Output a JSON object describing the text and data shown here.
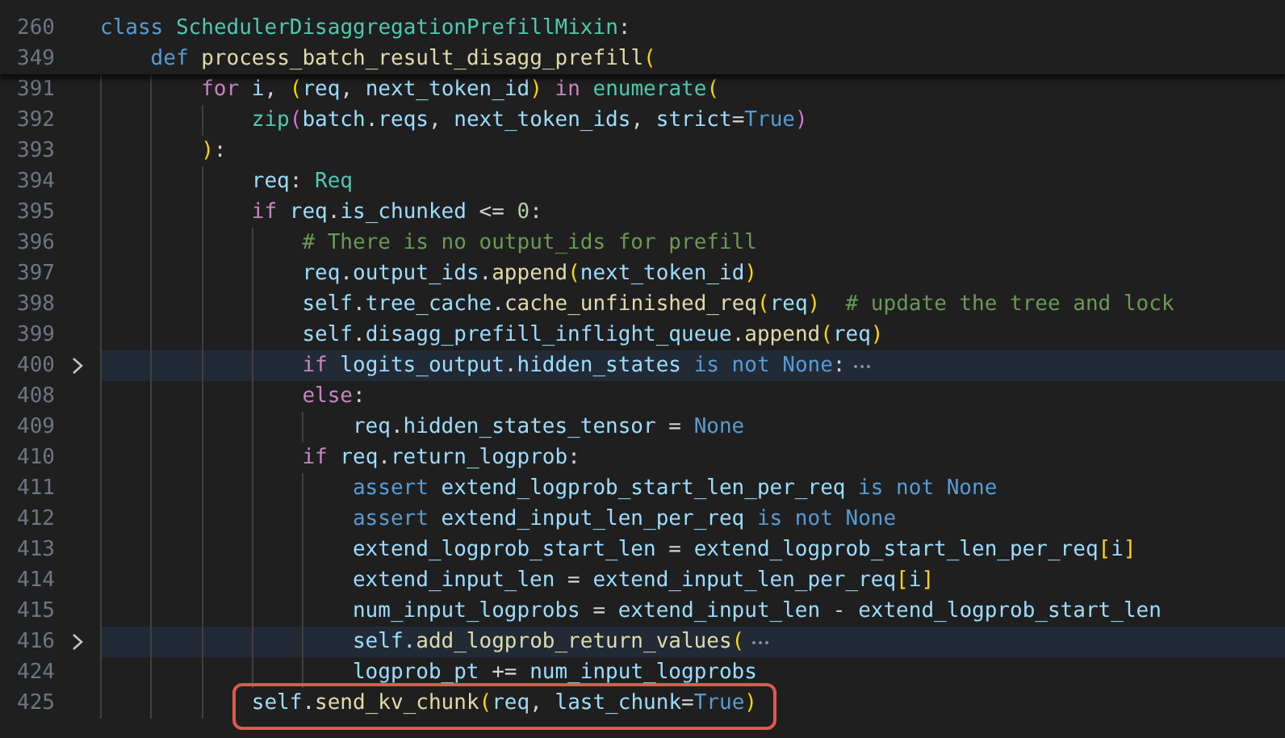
{
  "editor": {
    "sticky_lines": [
      {
        "number": "260",
        "segments": [
          {
            "kind": "kw",
            "text": "class "
          },
          {
            "kind": "cls",
            "text": "SchedulerDisaggregationPrefillMixin"
          },
          {
            "kind": "plain",
            "text": ":"
          }
        ],
        "children": [
          {
            "number": "349",
            "segments": [
              {
                "kind": "kw",
                "text": "def "
              },
              {
                "kind": "fn",
                "text": "process_batch_result_disagg_prefill"
              },
              {
                "kind": "b1",
                "text": "("
              }
            ]
          }
        ]
      }
    ],
    "lines": [
      {
        "number": "391",
        "folded": false,
        "boxed": false,
        "segments": [
          {
            "kind": "ctl",
            "text": "for "
          },
          {
            "kind": "var",
            "text": "i"
          },
          {
            "kind": "plain",
            "text": ", "
          },
          {
            "kind": "b1",
            "text": "("
          },
          {
            "kind": "var",
            "text": "req"
          },
          {
            "kind": "plain",
            "text": ", "
          },
          {
            "kind": "var",
            "text": "next_token_id"
          },
          {
            "kind": "b1",
            "text": ")"
          },
          {
            "kind": "ctl",
            "text": " in "
          },
          {
            "kind": "cls",
            "text": "enumerate"
          },
          {
            "kind": "b1",
            "text": "("
          }
        ],
        "children": [
          {
            "number": "392",
            "folded": false,
            "boxed": false,
            "segments": [
              {
                "kind": "cls",
                "text": "zip"
              },
              {
                "kind": "b2",
                "text": "("
              },
              {
                "kind": "var",
                "text": "batch"
              },
              {
                "kind": "plain",
                "text": "."
              },
              {
                "kind": "var",
                "text": "reqs"
              },
              {
                "kind": "plain",
                "text": ", "
              },
              {
                "kind": "var",
                "text": "next_token_ids"
              },
              {
                "kind": "plain",
                "text": ", "
              },
              {
                "kind": "var",
                "text": "strict"
              },
              {
                "kind": "plain",
                "text": "="
              },
              {
                "kind": "kw",
                "text": "True"
              },
              {
                "kind": "b2",
                "text": ")"
              }
            ]
          }
        ]
      },
      {
        "number": "393",
        "folded": false,
        "boxed": false,
        "segments": [
          {
            "kind": "b1",
            "text": ")"
          },
          {
            "kind": "plain",
            "text": ":"
          }
        ],
        "children": [
          {
            "number": "394",
            "folded": false,
            "boxed": false,
            "segments": [
              {
                "kind": "var",
                "text": "req"
              },
              {
                "kind": "plain",
                "text": ": "
              },
              {
                "kind": "cls",
                "text": "Req"
              }
            ]
          },
          {
            "number": "395",
            "folded": false,
            "boxed": false,
            "segments": [
              {
                "kind": "ctl",
                "text": "if "
              },
              {
                "kind": "var",
                "text": "req"
              },
              {
                "kind": "plain",
                "text": "."
              },
              {
                "kind": "var",
                "text": "is_chunked"
              },
              {
                "kind": "plain",
                "text": " <= "
              },
              {
                "kind": "num",
                "text": "0"
              },
              {
                "kind": "plain",
                "text": ":"
              }
            ],
            "children": [
              {
                "number": "396",
                "folded": false,
                "boxed": false,
                "segments": [
                  {
                    "kind": "comment",
                    "text": "# There is no output_ids for prefill"
                  }
                ]
              },
              {
                "number": "397",
                "folded": false,
                "boxed": false,
                "segments": [
                  {
                    "kind": "var",
                    "text": "req"
                  },
                  {
                    "kind": "plain",
                    "text": "."
                  },
                  {
                    "kind": "var",
                    "text": "output_ids"
                  },
                  {
                    "kind": "plain",
                    "text": "."
                  },
                  {
                    "kind": "fn",
                    "text": "append"
                  },
                  {
                    "kind": "b1",
                    "text": "("
                  },
                  {
                    "kind": "var",
                    "text": "next_token_id"
                  },
                  {
                    "kind": "b1",
                    "text": ")"
                  }
                ]
              },
              {
                "number": "398",
                "folded": false,
                "boxed": false,
                "segments": [
                  {
                    "kind": "var",
                    "text": "self"
                  },
                  {
                    "kind": "plain",
                    "text": "."
                  },
                  {
                    "kind": "var",
                    "text": "tree_cache"
                  },
                  {
                    "kind": "plain",
                    "text": "."
                  },
                  {
                    "kind": "fn",
                    "text": "cache_unfinished_req"
                  },
                  {
                    "kind": "b1",
                    "text": "("
                  },
                  {
                    "kind": "var",
                    "text": "req"
                  },
                  {
                    "kind": "b1",
                    "text": ")"
                  },
                  {
                    "kind": "comment",
                    "text": "  # update the tree and lock"
                  }
                ]
              },
              {
                "number": "399",
                "folded": false,
                "boxed": false,
                "segments": [
                  {
                    "kind": "var",
                    "text": "self"
                  },
                  {
                    "kind": "plain",
                    "text": "."
                  },
                  {
                    "kind": "var",
                    "text": "disagg_prefill_inflight_queue"
                  },
                  {
                    "kind": "plain",
                    "text": "."
                  },
                  {
                    "kind": "fn",
                    "text": "append"
                  },
                  {
                    "kind": "b1",
                    "text": "("
                  },
                  {
                    "kind": "var",
                    "text": "req"
                  },
                  {
                    "kind": "b1",
                    "text": ")"
                  }
                ]
              },
              {
                "number": "400",
                "folded": true,
                "boxed": false,
                "segments": [
                  {
                    "kind": "ctl",
                    "text": "if "
                  },
                  {
                    "kind": "var",
                    "text": "logits_output"
                  },
                  {
                    "kind": "plain",
                    "text": "."
                  },
                  {
                    "kind": "var",
                    "text": "hidden_states"
                  },
                  {
                    "kind": "kw",
                    "text": " is not None"
                  },
                  {
                    "kind": "plain",
                    "text": ":"
                  }
                ]
              },
              {
                "number": "408",
                "folded": false,
                "boxed": false,
                "segments": [
                  {
                    "kind": "ctl",
                    "text": "else"
                  },
                  {
                    "kind": "plain",
                    "text": ":"
                  }
                ],
                "children": [
                  {
                    "number": "409",
                    "folded": false,
                    "boxed": false,
                    "segments": [
                      {
                        "kind": "var",
                        "text": "req"
                      },
                      {
                        "kind": "plain",
                        "text": "."
                      },
                      {
                        "kind": "var",
                        "text": "hidden_states_tensor"
                      },
                      {
                        "kind": "plain",
                        "text": " = "
                      },
                      {
                        "kind": "kw",
                        "text": "None"
                      }
                    ]
                  }
                ]
              },
              {
                "number": "410",
                "folded": false,
                "boxed": false,
                "segments": [
                  {
                    "kind": "ctl",
                    "text": "if "
                  },
                  {
                    "kind": "var",
                    "text": "req"
                  },
                  {
                    "kind": "plain",
                    "text": "."
                  },
                  {
                    "kind": "var",
                    "text": "return_logprob"
                  },
                  {
                    "kind": "plain",
                    "text": ":"
                  }
                ],
                "children": [
                  {
                    "number": "411",
                    "folded": false,
                    "boxed": false,
                    "segments": [
                      {
                        "kind": "kw",
                        "text": "assert "
                      },
                      {
                        "kind": "var",
                        "text": "extend_logprob_start_len_per_req"
                      },
                      {
                        "kind": "kw",
                        "text": " is not None"
                      }
                    ]
                  },
                  {
                    "number": "412",
                    "folded": false,
                    "boxed": false,
                    "segments": [
                      {
                        "kind": "kw",
                        "text": "assert "
                      },
                      {
                        "kind": "var",
                        "text": "extend_input_len_per_req"
                      },
                      {
                        "kind": "kw",
                        "text": " is not None"
                      }
                    ]
                  },
                  {
                    "number": "413",
                    "folded": false,
                    "boxed": false,
                    "segments": [
                      {
                        "kind": "var",
                        "text": "extend_logprob_start_len"
                      },
                      {
                        "kind": "plain",
                        "text": " = "
                      },
                      {
                        "kind": "var",
                        "text": "extend_logprob_start_len_per_req"
                      },
                      {
                        "kind": "b1",
                        "text": "["
                      },
                      {
                        "kind": "var",
                        "text": "i"
                      },
                      {
                        "kind": "b1",
                        "text": "]"
                      }
                    ]
                  },
                  {
                    "number": "414",
                    "folded": false,
                    "boxed": false,
                    "segments": [
                      {
                        "kind": "var",
                        "text": "extend_input_len"
                      },
                      {
                        "kind": "plain",
                        "text": " = "
                      },
                      {
                        "kind": "var",
                        "text": "extend_input_len_per_req"
                      },
                      {
                        "kind": "b1",
                        "text": "["
                      },
                      {
                        "kind": "var",
                        "text": "i"
                      },
                      {
                        "kind": "b1",
                        "text": "]"
                      }
                    ]
                  },
                  {
                    "number": "415",
                    "folded": false,
                    "boxed": false,
                    "segments": [
                      {
                        "kind": "var",
                        "text": "num_input_logprobs"
                      },
                      {
                        "kind": "plain",
                        "text": " = "
                      },
                      {
                        "kind": "var",
                        "text": "extend_input_len"
                      },
                      {
                        "kind": "plain",
                        "text": " - "
                      },
                      {
                        "kind": "var",
                        "text": "extend_logprob_start_len"
                      }
                    ]
                  },
                  {
                    "number": "416",
                    "folded": true,
                    "boxed": false,
                    "segments": [
                      {
                        "kind": "var",
                        "text": "self."
                      },
                      {
                        "kind": "fn",
                        "text": "add_logprob_return_values"
                      },
                      {
                        "kind": "b1",
                        "text": "("
                      }
                    ]
                  },
                  {
                    "number": "424",
                    "folded": false,
                    "boxed": false,
                    "segments": [
                      {
                        "kind": "var",
                        "text": "logprob_pt"
                      },
                      {
                        "kind": "plain",
                        "text": " += "
                      },
                      {
                        "kind": "var",
                        "text": "num_input_logprobs"
                      }
                    ]
                  }
                ]
              }
            ]
          },
          {
            "number": "425",
            "folded": false,
            "boxed": true,
            "segments": [
              {
                "kind": "var",
                "text": "self"
              },
              {
                "kind": "plain",
                "text": "."
              },
              {
                "kind": "fn",
                "text": "send_kv_chunk"
              },
              {
                "kind": "b1",
                "text": "("
              },
              {
                "kind": "var",
                "text": "req"
              },
              {
                "kind": "plain",
                "text": ", "
              },
              {
                "kind": "var",
                "text": "last_chunk"
              },
              {
                "kind": "plain",
                "text": "="
              },
              {
                "kind": "kw",
                "text": "True"
              },
              {
                "kind": "b1",
                "text": ")"
              }
            ]
          }
        ]
      }
    ]
  }
}
